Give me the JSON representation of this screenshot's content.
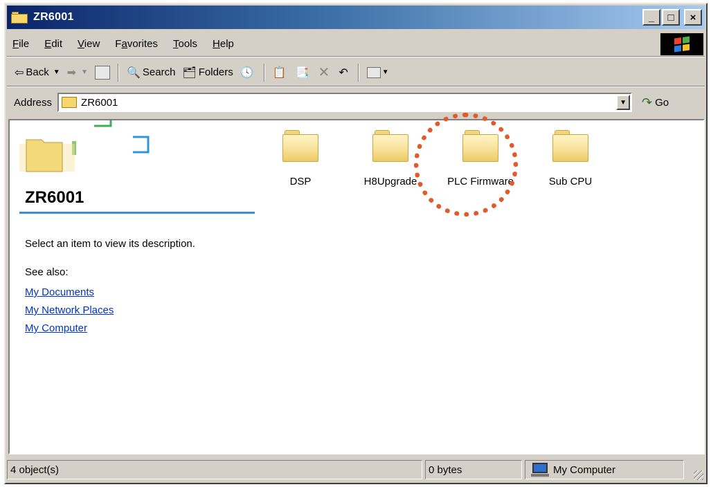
{
  "window": {
    "title": "ZR6001",
    "controls": {
      "minimize": "_",
      "maximize": "□",
      "close": "×"
    }
  },
  "menu": [
    {
      "label": "File",
      "key": "F",
      "rest": "ile"
    },
    {
      "label": "Edit",
      "key": "E",
      "rest": "dit"
    },
    {
      "label": "View",
      "key": "V",
      "rest": "iew"
    },
    {
      "label": "Favorites",
      "pre": "F",
      "key": "a",
      "rest": "vorites"
    },
    {
      "label": "Tools",
      "key": "T",
      "rest": "ools"
    },
    {
      "label": "Help",
      "key": "H",
      "rest": "elp"
    }
  ],
  "toolbar": {
    "back": "Back",
    "search": "Search",
    "folders": "Folders"
  },
  "address": {
    "label": "Address",
    "value": "ZR6001",
    "go": "Go"
  },
  "left_panel": {
    "title": "ZR6001",
    "description": "Select an item to view its description.",
    "see_also": "See also:",
    "links": [
      "My Documents",
      "My Network Places",
      "My Computer"
    ]
  },
  "items": [
    "DSP",
    "H8Upgrade",
    "PLC Firmware",
    "Sub CPU"
  ],
  "highlight": {
    "target": "PLC Firmware",
    "color": "#e05a2a"
  },
  "status": {
    "objects": "4 object(s)",
    "size": "0 bytes",
    "location": "My Computer"
  },
  "colors": {
    "titlebar_start": "#0a246a",
    "titlebar_end": "#a6caf0",
    "link": "#0033cc",
    "panel_underline": "#3b8fd6"
  }
}
